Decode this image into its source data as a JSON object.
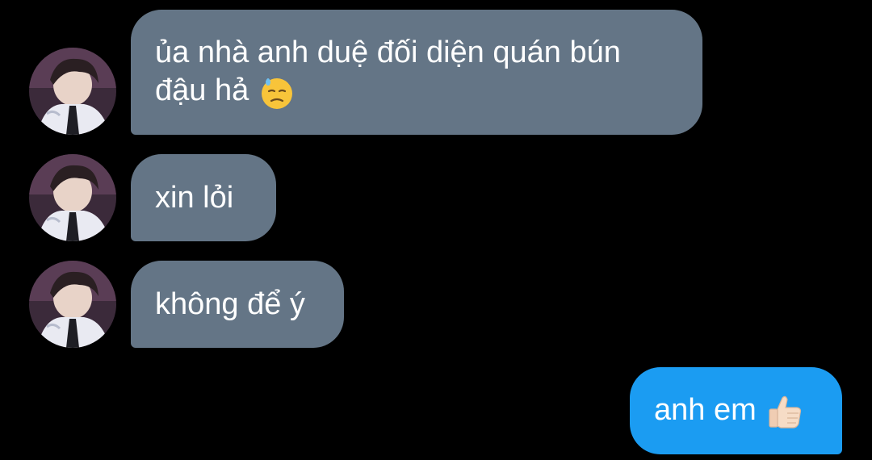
{
  "theme": {
    "background": "#000000",
    "incoming_bubble": "#647586",
    "outgoing_bubble": "#1b9cf2",
    "text": "#ffffff"
  },
  "messages": [
    {
      "direction": "incoming",
      "text": "ủa nhà anh duệ đối diện quán bún\nđậu hả",
      "emoji": "downcast-face-with-sweat-icon",
      "has_avatar": true
    },
    {
      "direction": "incoming",
      "text": "xin lỏi",
      "has_avatar": true
    },
    {
      "direction": "incoming",
      "text": "không để ý",
      "has_avatar": true
    },
    {
      "direction": "outgoing",
      "text": "anh em",
      "emoji": "thumbs-up-light-skin-icon"
    }
  ]
}
